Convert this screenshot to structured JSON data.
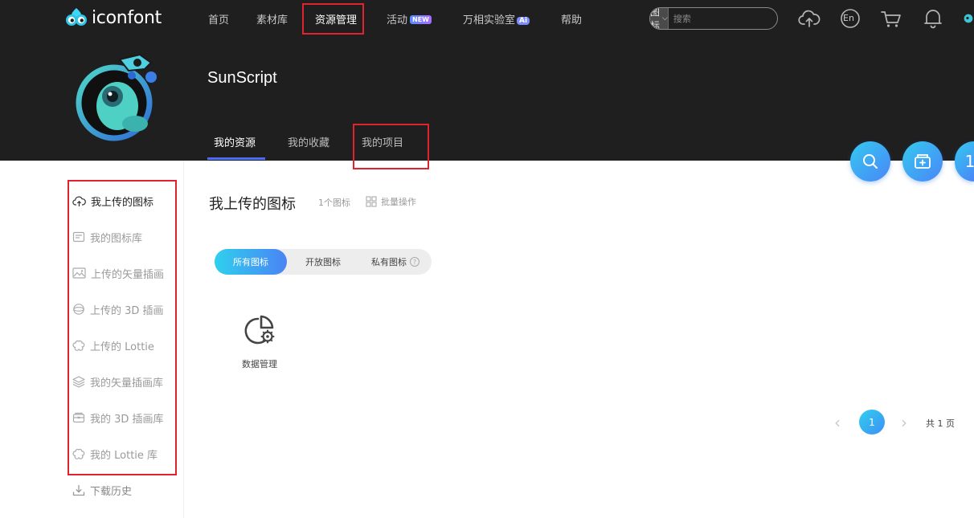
{
  "header": {
    "logo_text": "iconfont",
    "nav": [
      {
        "label": "首页"
      },
      {
        "label": "素材库"
      },
      {
        "label": "资源管理"
      },
      {
        "label": "活动",
        "badge": "NEW"
      },
      {
        "label": "万相实验室",
        "badge": "Ai"
      },
      {
        "label": "帮助"
      }
    ],
    "search": {
      "type": "图标",
      "placeholder": "搜索"
    },
    "lang": "En"
  },
  "profile": {
    "username": "SunScript",
    "tabs": [
      {
        "label": "我的资源"
      },
      {
        "label": "我的收藏"
      },
      {
        "label": "我的项目"
      }
    ]
  },
  "fab": {
    "partial_label": "1"
  },
  "sidebar": {
    "items": [
      {
        "label": "我上传的图标",
        "icon": "upload-icon"
      },
      {
        "label": "我的图标库",
        "icon": "library-icon"
      },
      {
        "label": "上传的矢量插画",
        "icon": "image-icon"
      },
      {
        "label": "上传的 3D 插画",
        "icon": "sphere-icon"
      },
      {
        "label": "上传的 Lottie",
        "icon": "lottie-icon"
      },
      {
        "label": "我的矢量插画库",
        "icon": "layers-icon"
      },
      {
        "label": "我的 3D 插画库",
        "icon": "box-icon"
      },
      {
        "label": "我的 Lottie 库",
        "icon": "lottie-icon"
      },
      {
        "label": "下载历史",
        "icon": "download-icon"
      }
    ]
  },
  "main": {
    "title": "我上传的图标",
    "count": "1个图标",
    "batch_label": "批量操作",
    "filters": [
      {
        "label": "所有图标"
      },
      {
        "label": "开放图标"
      },
      {
        "label": "私有图标"
      }
    ],
    "filter_help": "?",
    "icons": [
      {
        "name": "数据管理",
        "icon": "chart-gear-icon"
      }
    ]
  },
  "pagination": {
    "current": "1",
    "total_text": "共 1 页",
    "prev": "‹",
    "next": "›"
  },
  "colors": {
    "header_bg": "#1f1f1f",
    "accent": "#4a6cf7",
    "gradient_start": "#2fd0ee",
    "gradient_end": "#4a83f5",
    "annotation_red": "#e0232f"
  }
}
